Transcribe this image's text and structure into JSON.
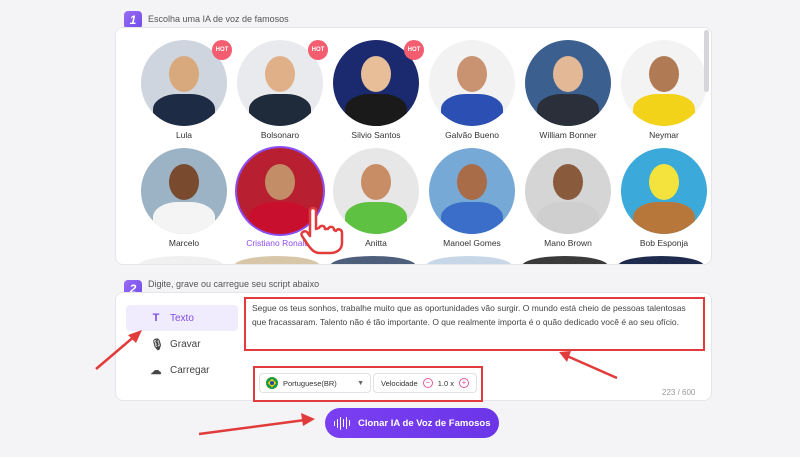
{
  "step1": {
    "number": "1",
    "title": "Escolha uma IA de voz de famosos"
  },
  "hot_label": "HOT",
  "voices": [
    {
      "name": "Lula",
      "hot": true,
      "bg": "#cfd5df",
      "skin": "#d9a97e",
      "suit": "#1e2b44"
    },
    {
      "name": "Bolsonaro",
      "hot": true,
      "bg": "#e9eaee",
      "skin": "#e0b089",
      "suit": "#1f2a3b"
    },
    {
      "name": "Silvio Santos",
      "hot": true,
      "bg": "#1b2a6e",
      "skin": "#e8be98",
      "suit": "#1a1a1a"
    },
    {
      "name": "Galvão Bueno",
      "hot": false,
      "bg": "#f2f2f2",
      "skin": "#c99270",
      "suit": "#2b4fb3"
    },
    {
      "name": "William Bonner",
      "hot": false,
      "bg": "#3b5f8f",
      "skin": "#e3b896",
      "suit": "#2a2f3a"
    },
    {
      "name": "Neymar",
      "hot": false,
      "bg": "#f3f3f3",
      "skin": "#b07a55",
      "suit": "#f3d31a"
    },
    {
      "name": "Marcelo",
      "hot": false,
      "bg": "#9bb3c4",
      "skin": "#7a4a2f",
      "suit": "#f4f4f4"
    },
    {
      "name": "Cristiano Ronaldo",
      "hot": false,
      "bg": "#b82031",
      "skin": "#c38d68",
      "suit": "#c8102e",
      "selected": true
    },
    {
      "name": "Anitta",
      "hot": false,
      "bg": "#e7e7e7",
      "skin": "#c98d66",
      "suit": "#5fc141"
    },
    {
      "name": "Manoel Gomes",
      "hot": false,
      "bg": "#77a9d6",
      "skin": "#a86c48",
      "suit": "#3a6ec8"
    },
    {
      "name": "Mano Brown",
      "hot": false,
      "bg": "#d5d5d5",
      "skin": "#8a5a3c",
      "suit": "#cfcfcf"
    },
    {
      "name": "Bob Esponja",
      "hot": false,
      "bg": "#3ba9d9",
      "skin": "#f5e33d",
      "suit": "#b8773a"
    }
  ],
  "step2": {
    "number": "2",
    "title": "Digite, grave ou carregue seu script abaixo"
  },
  "modes": [
    {
      "label": "Texto",
      "icon": "T",
      "active": true
    },
    {
      "label": "Gravar",
      "icon": "🎙",
      "active": false
    },
    {
      "label": "Carregar",
      "icon": "☁",
      "active": false
    }
  ],
  "script_text": "Segue os teus sonhos, trabalhe muito que as oportunidades vão surgir. O mundo está cheio de pessoas talentosas que fracassaram. Talento não é tão importante. O que realmente importa é o quão dedicado você é ao seu ofício.",
  "language": "Portuguese(BR)",
  "speed_label": "Velocidade",
  "speed_value": "1.0 x",
  "char_count": "223 / 600",
  "clone_button": "Clonar IA de Voz de Famosos",
  "colors": {
    "accent": "#7b3ff2",
    "highlight": "#e23b3b",
    "hot": "#f25e6f"
  }
}
